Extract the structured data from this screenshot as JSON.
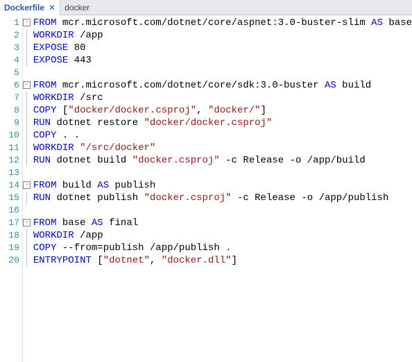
{
  "tabs": {
    "active": {
      "label": "Dockerfile",
      "close": "✕"
    },
    "inactive": {
      "label": "docker"
    }
  },
  "lines": [
    {
      "n": "1",
      "fold": "box",
      "tokens": [
        [
          "kw",
          "FROM"
        ],
        [
          "plain",
          " mcr.microsoft.com/dotnet/core/aspnet:3.0-buster-slim "
        ],
        [
          "kw",
          "AS"
        ],
        [
          "plain",
          " base"
        ]
      ]
    },
    {
      "n": "2",
      "fold": "line",
      "tokens": [
        [
          "kw",
          "WORKDIR"
        ],
        [
          "plain",
          " /app"
        ]
      ]
    },
    {
      "n": "3",
      "fold": "line",
      "tokens": [
        [
          "kw",
          "EXPOSE"
        ],
        [
          "plain",
          " 80"
        ]
      ]
    },
    {
      "n": "4",
      "fold": "line",
      "tokens": [
        [
          "kw",
          "EXPOSE"
        ],
        [
          "plain",
          " 443"
        ]
      ]
    },
    {
      "n": "5",
      "fold": "",
      "tokens": []
    },
    {
      "n": "6",
      "fold": "box",
      "tokens": [
        [
          "kw",
          "FROM"
        ],
        [
          "plain",
          " mcr.microsoft.com/dotnet/core/sdk:3.0-buster "
        ],
        [
          "kw",
          "AS"
        ],
        [
          "plain",
          " build"
        ]
      ]
    },
    {
      "n": "7",
      "fold": "line",
      "tokens": [
        [
          "kw",
          "WORKDIR"
        ],
        [
          "plain",
          " /src"
        ]
      ]
    },
    {
      "n": "8",
      "fold": "line",
      "tokens": [
        [
          "kw",
          "COPY"
        ],
        [
          "plain",
          " ["
        ],
        [
          "str",
          "\"docker/docker.csproj\""
        ],
        [
          "plain",
          ", "
        ],
        [
          "str",
          "\"docker/\""
        ],
        [
          "plain",
          "]"
        ]
      ]
    },
    {
      "n": "9",
      "fold": "line",
      "tokens": [
        [
          "kw",
          "RUN"
        ],
        [
          "plain",
          " dotnet restore "
        ],
        [
          "str",
          "\"docker/docker.csproj\""
        ]
      ]
    },
    {
      "n": "10",
      "fold": "line",
      "tokens": [
        [
          "kw",
          "COPY"
        ],
        [
          "plain",
          " . ."
        ]
      ]
    },
    {
      "n": "11",
      "fold": "line",
      "tokens": [
        [
          "kw",
          "WORKDIR"
        ],
        [
          "plain",
          " "
        ],
        [
          "str",
          "\"/src/docker\""
        ]
      ]
    },
    {
      "n": "12",
      "fold": "line",
      "tokens": [
        [
          "kw",
          "RUN"
        ],
        [
          "plain",
          " dotnet build "
        ],
        [
          "str",
          "\"docker.csproj\""
        ],
        [
          "plain",
          " -c Release -o /app/build"
        ]
      ]
    },
    {
      "n": "13",
      "fold": "",
      "tokens": []
    },
    {
      "n": "14",
      "fold": "box",
      "tokens": [
        [
          "kw",
          "FROM"
        ],
        [
          "plain",
          " build "
        ],
        [
          "kw",
          "AS"
        ],
        [
          "plain",
          " publish"
        ]
      ]
    },
    {
      "n": "15",
      "fold": "line",
      "tokens": [
        [
          "kw",
          "RUN"
        ],
        [
          "plain",
          " dotnet publish "
        ],
        [
          "str",
          "\"docker.csproj\""
        ],
        [
          "plain",
          " -c Release -o /app/publish"
        ]
      ]
    },
    {
      "n": "16",
      "fold": "",
      "tokens": []
    },
    {
      "n": "17",
      "fold": "box",
      "tokens": [
        [
          "kw",
          "FROM"
        ],
        [
          "plain",
          " base "
        ],
        [
          "kw",
          "AS"
        ],
        [
          "plain",
          " final"
        ]
      ]
    },
    {
      "n": "18",
      "fold": "line",
      "tokens": [
        [
          "kw",
          "WORKDIR"
        ],
        [
          "plain",
          " /app"
        ]
      ]
    },
    {
      "n": "19",
      "fold": "line",
      "tokens": [
        [
          "kw",
          "COPY"
        ],
        [
          "plain",
          " --from=publish /app/publish ."
        ]
      ]
    },
    {
      "n": "20",
      "fold": "line",
      "tokens": [
        [
          "kw",
          "ENTRYPOINT"
        ],
        [
          "plain",
          " ["
        ],
        [
          "str",
          "\"dotnet\""
        ],
        [
          "plain",
          ", "
        ],
        [
          "str",
          "\"docker.dll\""
        ],
        [
          "plain",
          "]"
        ]
      ]
    }
  ]
}
